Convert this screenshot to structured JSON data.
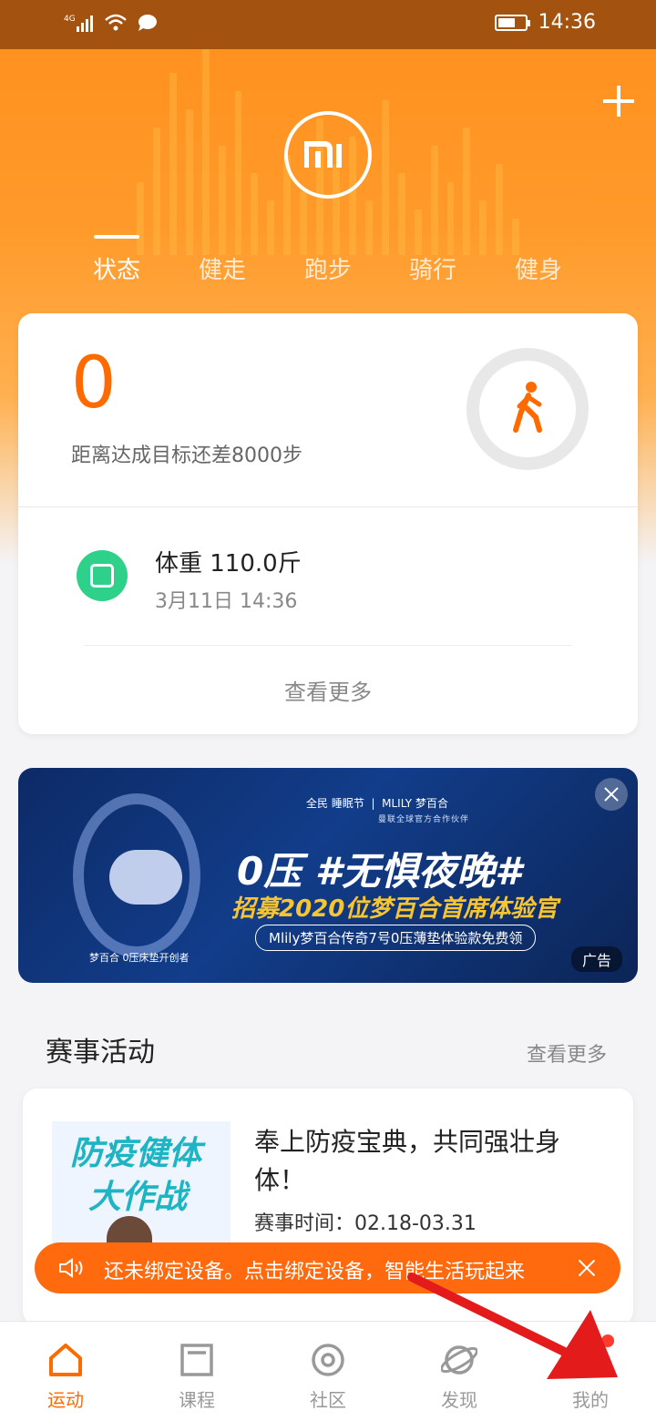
{
  "status_bar": {
    "network": "4G",
    "time": "14:36"
  },
  "tabs": [
    "状态",
    "健走",
    "跑步",
    "骑行",
    "健身"
  ],
  "steps": {
    "value": "0",
    "subtitle": "距离达成目标还差8000步"
  },
  "weight": {
    "title": "体重  110.0斤",
    "date": "3月11日  14:36"
  },
  "card_more": "查看更多",
  "ad": {
    "top_left": "全民 睡眠节",
    "top_right": "MLILY 梦百合",
    "top_sub": "曼联全球官方合作伙伴",
    "headline": "0压 #无惧夜晚#",
    "subheadline": "招募2020位梦百合首席体验官",
    "pill": "Mlily梦百合传奇7号0压薄垫体验款免费领",
    "brand": "梦百合 0压床垫开创者",
    "label": "广告"
  },
  "events_section": {
    "title": "赛事活动",
    "more": "查看更多"
  },
  "event": {
    "image_line1": "防疫健体",
    "image_line2": "大作战",
    "title": "奉上防疫宝典，共同强壮身体！",
    "time": "赛事时间：02.18-03.31"
  },
  "toast": {
    "text": "还未绑定设备。点击绑定设备，智能生活玩起来"
  },
  "nav": [
    {
      "label": "运动",
      "icon": "home-icon"
    },
    {
      "label": "课程",
      "icon": "course-icon"
    },
    {
      "label": "社区",
      "icon": "community-icon"
    },
    {
      "label": "发现",
      "icon": "discover-icon"
    },
    {
      "label": "我的",
      "icon": "profile-icon"
    }
  ],
  "colors": {
    "accent": "#ff6a00",
    "hero": "#ff9a2a",
    "weight_icon": "#2ed18a",
    "annotation_arrow": "#e31b1b"
  }
}
